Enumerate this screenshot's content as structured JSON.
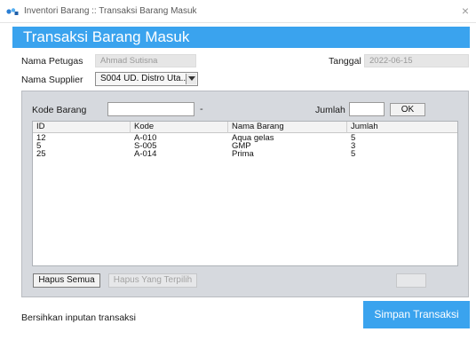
{
  "window": {
    "title": "Inventori Barang :: Transaksi Barang Masuk",
    "close_symbol": "×",
    "icon": "app-logo-icon"
  },
  "header": {
    "title": "Transaksi Barang Masuk"
  },
  "form": {
    "petugas_label": "Nama Petugas",
    "petugas_value": "Ahmad Sutisna",
    "tanggal_label": "Tanggal",
    "tanggal_value": "2022-06-15",
    "supplier_label": "Nama Supplier",
    "supplier_value": "S004 UD. Distro Uta..."
  },
  "entry": {
    "kode_label": "Kode Barang",
    "kode_value": "",
    "separator": "-",
    "jumlah_label": "Jumlah",
    "jumlah_value": "",
    "ok_label": "OK"
  },
  "table": {
    "columns": [
      "ID",
      "Kode",
      "Nama Barang",
      "Jumlah"
    ],
    "rows": [
      [
        "12",
        "A-010",
        "Aqua gelas",
        "5"
      ],
      [
        "5",
        "S-005",
        "GMP",
        "3"
      ],
      [
        "25",
        "A-014",
        "Prima",
        "5"
      ]
    ]
  },
  "actions": {
    "hapus_semua_label": "Hapus Semua",
    "hapus_terpilih_label": "Hapus Yang Terpilih"
  },
  "footer": {
    "status_text": "Bersihkan inputan transaksi",
    "simpan_label": "Simpan Transaksi"
  },
  "colors": {
    "accent": "#3aa3ee",
    "panel": "#d6d9de",
    "readonly_field": "#e6e6e6"
  }
}
